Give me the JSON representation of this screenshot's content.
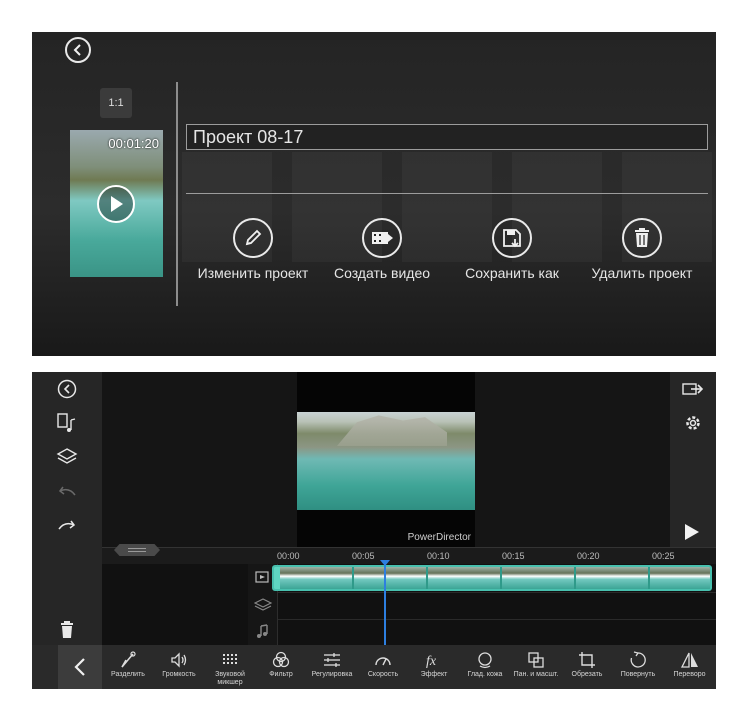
{
  "project_dialog": {
    "back_icon": "back-circle-icon",
    "aspect_ratio": "1:1",
    "thumbnail_duration": "00:01:20",
    "project_name": "Проект 08-17",
    "actions": [
      {
        "label": "Изменить проект",
        "icon": "pencil-icon"
      },
      {
        "label": "Создать видео",
        "icon": "film-arrow-icon"
      },
      {
        "label": "Сохранить как",
        "icon": "save-as-icon"
      },
      {
        "label": "Удалить проект",
        "icon": "trash-icon"
      }
    ]
  },
  "editor": {
    "left_toolbar": [
      "back-circle-icon",
      "media-music-icon",
      "layers-icon",
      "undo-icon",
      "redo-icon",
      "trash-icon"
    ],
    "right_toolbar": [
      "export-icon",
      "settings-gear-icon",
      "play-icon"
    ],
    "preview_watermark": "PowerDirector",
    "timeline": {
      "ticks": [
        "00:00",
        "00:05",
        "00:10",
        "00:15",
        "00:20",
        "00:25"
      ],
      "track_icons": [
        "video-track-icon",
        "overlay-track-icon",
        "audio-track-icon"
      ]
    },
    "tools": [
      {
        "label": "Разделить",
        "icon": "split-icon"
      },
      {
        "label": "Громкость",
        "icon": "volume-icon"
      },
      {
        "label": "Звуковой микшер",
        "icon": "mixer-icon"
      },
      {
        "label": "Фильтр",
        "icon": "filter-icon"
      },
      {
        "label": "Регулировка",
        "icon": "adjust-icon"
      },
      {
        "label": "Скорость",
        "icon": "speed-icon"
      },
      {
        "label": "Эффект",
        "icon": "fx-icon"
      },
      {
        "label": "Глад. кожа",
        "icon": "skin-smooth-icon"
      },
      {
        "label": "Пан. и масшт.",
        "icon": "pan-zoom-icon"
      },
      {
        "label": "Обрезать",
        "icon": "crop-icon"
      },
      {
        "label": "Повернуть",
        "icon": "rotate-icon"
      },
      {
        "label": "Переворо",
        "icon": "flip-icon"
      }
    ]
  }
}
